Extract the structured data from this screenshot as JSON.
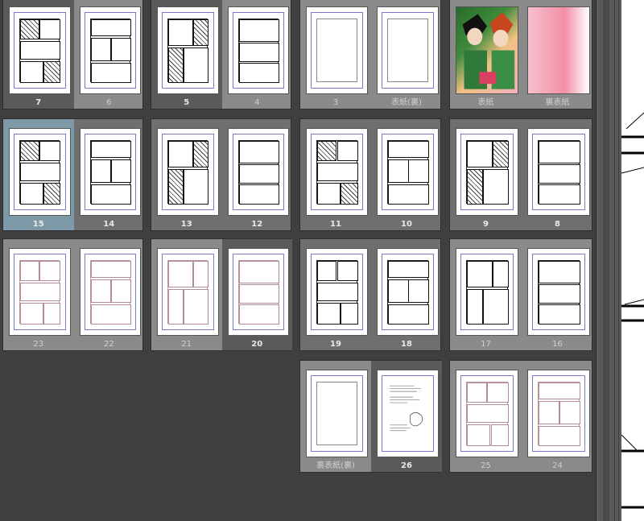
{
  "rows": [
    [
      {
        "pages": [
          {
            "label": "7",
            "type": "ink",
            "state": "sel"
          },
          {
            "label": "6",
            "type": "ink",
            "dim": true
          }
        ]
      },
      {
        "pages": [
          {
            "label": "5",
            "type": "ink",
            "state": "sel"
          },
          {
            "label": "4",
            "type": "ink",
            "dim": true
          }
        ]
      },
      {
        "pages": [
          {
            "label": "3",
            "type": "blank",
            "dim": true
          },
          {
            "label": "表紙(裏)",
            "type": "blank",
            "dim": true
          }
        ]
      },
      {
        "pages": [
          {
            "label": "表紙",
            "type": "cover",
            "dim": true
          },
          {
            "label": "裏表紙",
            "type": "cover",
            "dim": true
          }
        ],
        "cover": true
      }
    ],
    [
      {
        "pages": [
          {
            "label": "15",
            "type": "ink",
            "state": "hl"
          },
          {
            "label": "14",
            "type": "ink"
          }
        ],
        "dark": true
      },
      {
        "pages": [
          {
            "label": "13",
            "type": "ink"
          },
          {
            "label": "12",
            "type": "ink"
          }
        ],
        "dark": true
      },
      {
        "pages": [
          {
            "label": "11",
            "type": "ink"
          },
          {
            "label": "10",
            "type": "ink"
          }
        ],
        "dark": true
      },
      {
        "pages": [
          {
            "label": "9",
            "type": "ink"
          },
          {
            "label": "8",
            "type": "ink"
          }
        ],
        "dark": true
      }
    ],
    [
      {
        "pages": [
          {
            "label": "23",
            "type": "sketch",
            "dim": true
          },
          {
            "label": "22",
            "type": "sketch",
            "dim": true
          }
        ]
      },
      {
        "pages": [
          {
            "label": "21",
            "type": "sketch",
            "dim": true
          },
          {
            "label": "20",
            "type": "sketch",
            "state": "sel"
          }
        ]
      },
      {
        "pages": [
          {
            "label": "19",
            "type": "pencil"
          },
          {
            "label": "18",
            "type": "pencil"
          }
        ],
        "dark": true
      },
      {
        "pages": [
          {
            "label": "17",
            "type": "pencil",
            "dim": true
          },
          {
            "label": "16",
            "type": "pencil",
            "dim": true
          }
        ]
      }
    ],
    [
      null,
      null,
      {
        "pages": [
          {
            "label": "裏表紙(裏)",
            "type": "blank",
            "dim": true
          },
          {
            "label": "26",
            "type": "text",
            "state": "sel"
          }
        ]
      },
      {
        "pages": [
          {
            "label": "25",
            "type": "sketch",
            "dim": true
          },
          {
            "label": "24",
            "type": "sketch",
            "dim": true
          }
        ]
      }
    ]
  ]
}
